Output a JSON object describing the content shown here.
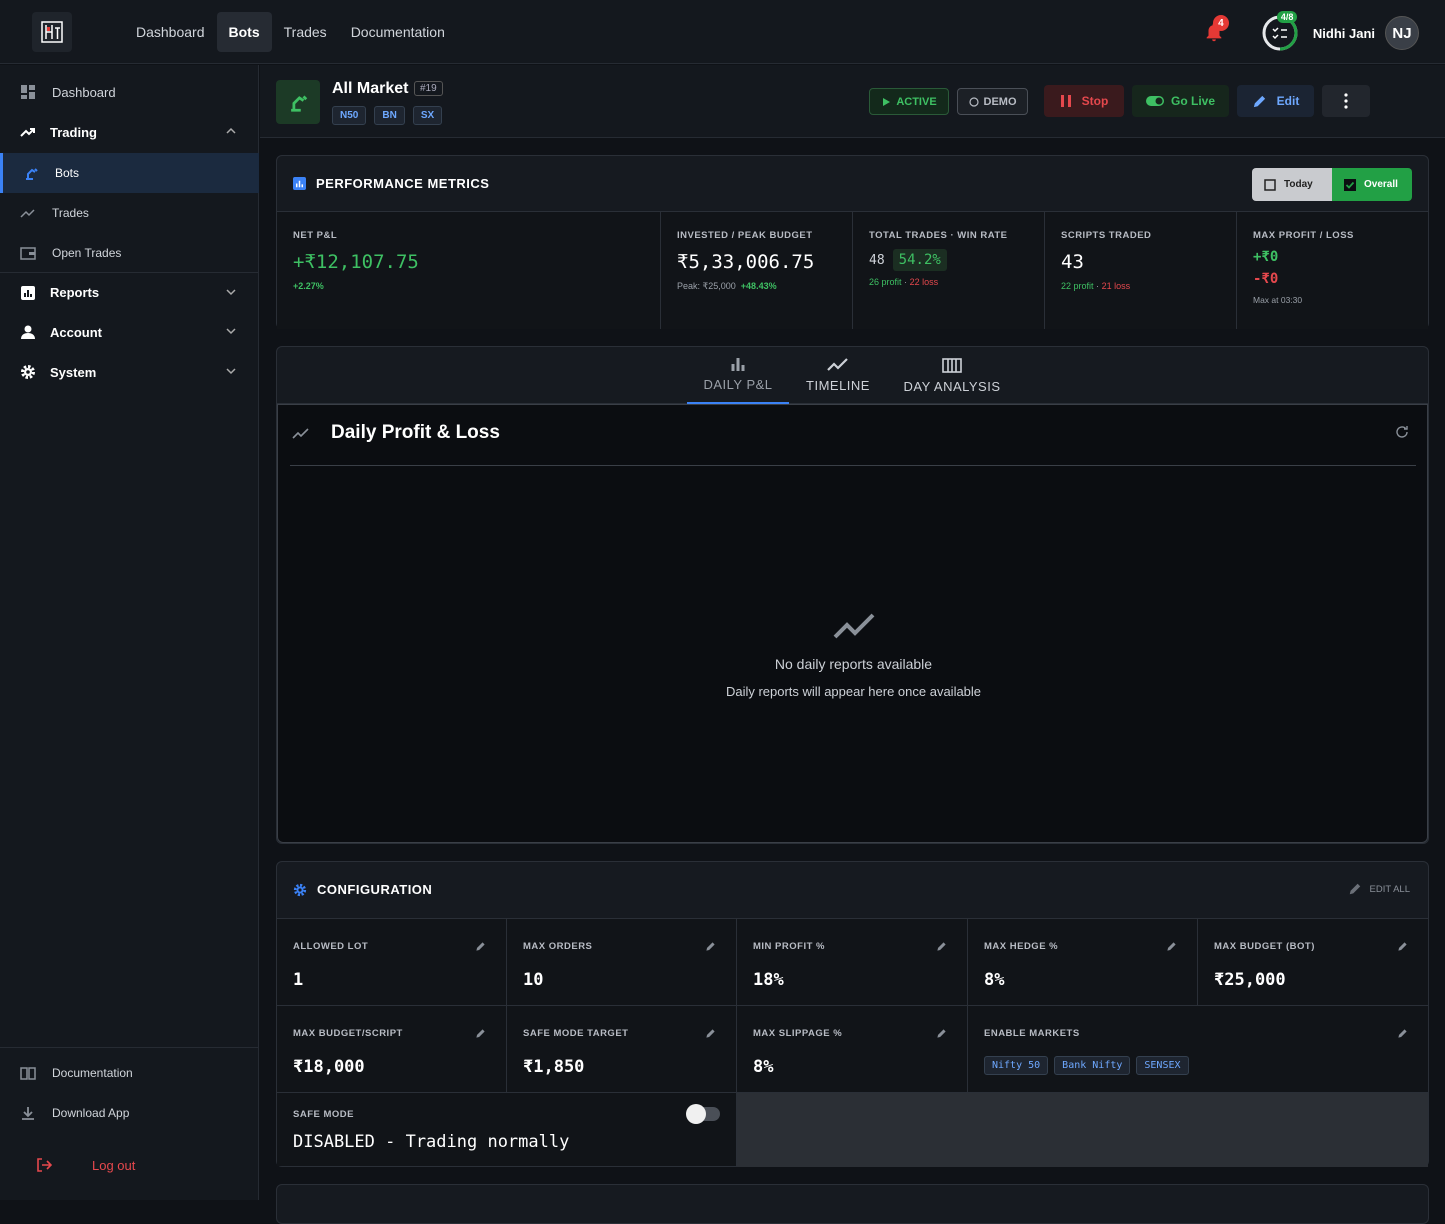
{
  "topbar": {
    "nav": [
      "Dashboard",
      "Bots",
      "Trades",
      "Documentation"
    ],
    "active_nav": "Bots",
    "notification_count": "4",
    "task_progress": "4/8",
    "user_name": "Nidhi Jani",
    "user_initials": "NJ"
  },
  "sidebar": {
    "items": [
      {
        "label": "Dashboard"
      },
      {
        "label": "Trading"
      },
      {
        "label": "Bots"
      },
      {
        "label": "Trades"
      },
      {
        "label": "Open Trades"
      },
      {
        "label": "Reports"
      },
      {
        "label": "Account"
      },
      {
        "label": "System"
      }
    ],
    "bottom": {
      "documentation": "Documentation",
      "download": "Download App",
      "logout": "Log out"
    }
  },
  "bot": {
    "name": "All Market",
    "id": "#19",
    "tags": [
      "N50",
      "BN",
      "SX"
    ],
    "status_active": "ACTIVE",
    "status_demo": "DEMO",
    "stop_label": "Stop",
    "golive_label": "Go Live",
    "edit_label": "Edit"
  },
  "performance": {
    "title": "PERFORMANCE METRICS",
    "toggle_today": "Today",
    "toggle_overall": "Overall",
    "net_pnl_label": "NET P&L",
    "net_pnl_value": "+₹12,107.75",
    "net_pnl_pct": "+2.27%",
    "invested_label": "INVESTED / PEAK BUDGET",
    "invested_value": "₹5,33,006.75",
    "peak_label": "Peak: ₹25,000",
    "peak_pct": "+48.43%",
    "trades_label": "TOTAL TRADES · WIN RATE",
    "trades_count": "48",
    "win_rate": "54.2%",
    "trades_profit": "26 profit",
    "trades_loss": "22 loss",
    "scripts_label": "SCRIPTS TRADED",
    "scripts_value": "43",
    "scripts_profit": "22 profit",
    "scripts_loss": "21 loss",
    "maxpl_label": "MAX PROFIT / LOSS",
    "max_profit": "+₹0",
    "max_loss": "-₹0",
    "max_at": "Max at 03:30"
  },
  "tabs": {
    "items": [
      "DAILY P&L",
      "TIMELINE",
      "DAY ANALYSIS"
    ],
    "active": "DAILY P&L"
  },
  "daily_pnl": {
    "title": "Daily Profit & Loss",
    "empty_title": "No daily reports available",
    "empty_sub": "Daily reports will appear here once available"
  },
  "configuration": {
    "title": "CONFIGURATION",
    "edit_all": "EDIT ALL",
    "fields": [
      {
        "label": "ALLOWED LOT",
        "value": "1"
      },
      {
        "label": "MAX ORDERS",
        "value": "10"
      },
      {
        "label": "MIN PROFIT %",
        "value": "18%"
      },
      {
        "label": "MAX HEDGE %",
        "value": "8%"
      },
      {
        "label": "MAX BUDGET (BOT)",
        "value": "₹25,000"
      },
      {
        "label": "MAX BUDGET/SCRIPT",
        "value": "₹18,000"
      },
      {
        "label": "SAFE MODE TARGET",
        "value": "₹1,850"
      },
      {
        "label": "MAX SLIPPAGE %",
        "value": "8%"
      }
    ],
    "markets_label": "ENABLE MARKETS",
    "markets": [
      "Nifty 50",
      "Bank Nifty",
      "SENSEX"
    ],
    "safe_mode_label": "SAFE MODE",
    "safe_mode_value": "DISABLED - Trading normally"
  }
}
